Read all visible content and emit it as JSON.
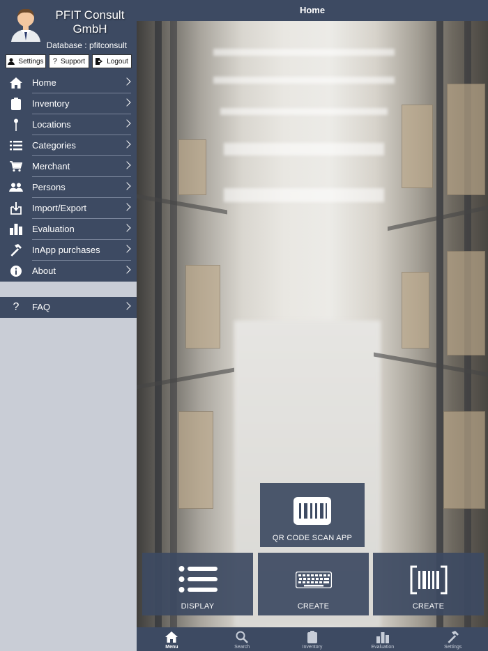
{
  "profile": {
    "company": "PFIT Consult GmbH",
    "database": "Database : pfitconsult",
    "buttons": {
      "settings": "Settings",
      "support": "Support",
      "logout": "Logout"
    }
  },
  "menu": {
    "items": [
      {
        "label": "Home",
        "icon": "home-icon"
      },
      {
        "label": "Inventory",
        "icon": "clipboard-icon"
      },
      {
        "label": "Locations",
        "icon": "pin-icon"
      },
      {
        "label": "Categories",
        "icon": "list-icon"
      },
      {
        "label": "Merchant",
        "icon": "cart-icon"
      },
      {
        "label": "Persons",
        "icon": "people-icon"
      },
      {
        "label": "Import/Export",
        "icon": "download-icon"
      },
      {
        "label": "Evaluation",
        "icon": "bar-chart-icon"
      },
      {
        "label": "InApp purchases",
        "icon": "hammer-icon"
      },
      {
        "label": "About",
        "icon": "info-icon"
      }
    ],
    "faq": {
      "label": "FAQ",
      "icon": "question-icon"
    }
  },
  "main": {
    "title": "Home",
    "tiles": {
      "qr": "QR CODE SCAN APP",
      "display": "DISPLAY",
      "create_keyboard": "CREATE",
      "create_barcode": "CREATE"
    }
  },
  "tabbar": {
    "tabs": [
      {
        "label": "Menu",
        "icon": "home-icon",
        "active": true
      },
      {
        "label": "Search",
        "icon": "search-icon",
        "active": false
      },
      {
        "label": "Inventory",
        "icon": "clipboard-icon",
        "active": false
      },
      {
        "label": "Evaluation",
        "icon": "bar-chart-icon",
        "active": false
      },
      {
        "label": "Settings",
        "icon": "hammer-icon",
        "active": false
      }
    ]
  },
  "colors": {
    "navy": "#3d4a62",
    "sidebar_bg": "#c9cdd6",
    "divider": "#7a859b"
  }
}
